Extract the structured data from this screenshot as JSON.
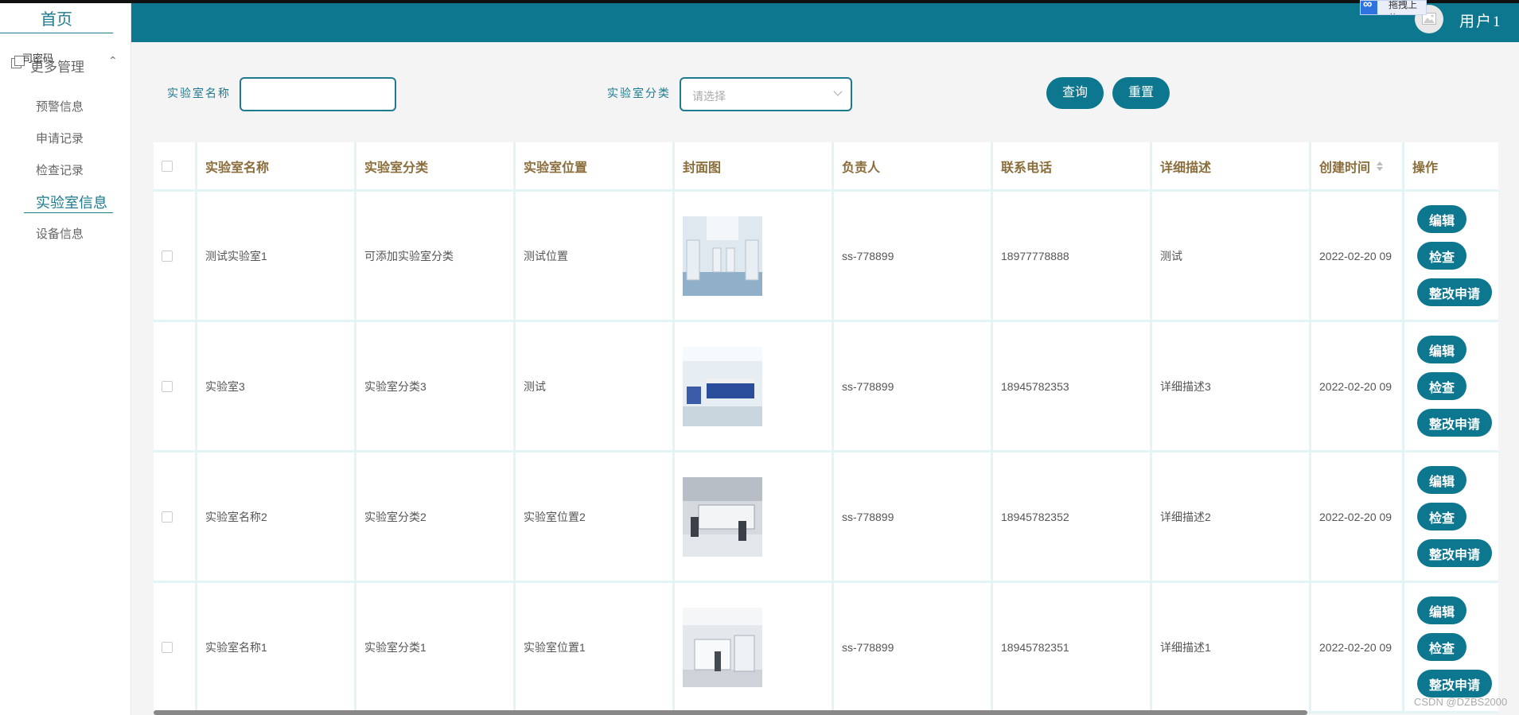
{
  "sidebar": {
    "home": "首页",
    "group_title": "更多管理",
    "group_overlay": "司密码",
    "items": [
      {
        "label": "预警信息"
      },
      {
        "label": "申请记录"
      },
      {
        "label": "检查记录"
      },
      {
        "label": "实验室信息",
        "active": true
      },
      {
        "label": "设备信息"
      }
    ]
  },
  "header": {
    "username": "用户1",
    "upload_badge": "拖拽上传",
    "bg_color": "#0d7790"
  },
  "search": {
    "name_label": "实验室名称",
    "name_value": "",
    "category_label": "实验室分类",
    "category_placeholder": "请选择",
    "query_btn": "查询",
    "reset_btn": "重置"
  },
  "table": {
    "columns": [
      "实验室名称",
      "实验室分类",
      "实验室位置",
      "封面图",
      "负责人",
      "联系电话",
      "详细描述",
      "创建时间",
      "操作"
    ],
    "rows": [
      {
        "name": "测试实验室1",
        "category": "可添加实验室分类",
        "location": "测试位置",
        "owner": "ss-778899",
        "phone": "18977778888",
        "desc": "测试",
        "created": "2022-02-20 09"
      },
      {
        "name": "实验室3",
        "category": "实验室分类3",
        "location": "测试",
        "owner": "ss-778899",
        "phone": "18945782353",
        "desc": "详细描述3",
        "created": "2022-02-20 09"
      },
      {
        "name": "实验室名称2",
        "category": "实验室分类2",
        "location": "实验室位置2",
        "owner": "ss-778899",
        "phone": "18945782352",
        "desc": "详细描述2",
        "created": "2022-02-20 09"
      },
      {
        "name": "实验室名称1",
        "category": "实验室分类1",
        "location": "实验室位置1",
        "owner": "ss-778899",
        "phone": "18945782351",
        "desc": "详细描述1",
        "created": "2022-02-20 09"
      }
    ],
    "actions": {
      "edit": "编辑",
      "check": "检查",
      "rectify": "整改申请"
    }
  },
  "watermark": "CSDN @DZBS2000"
}
